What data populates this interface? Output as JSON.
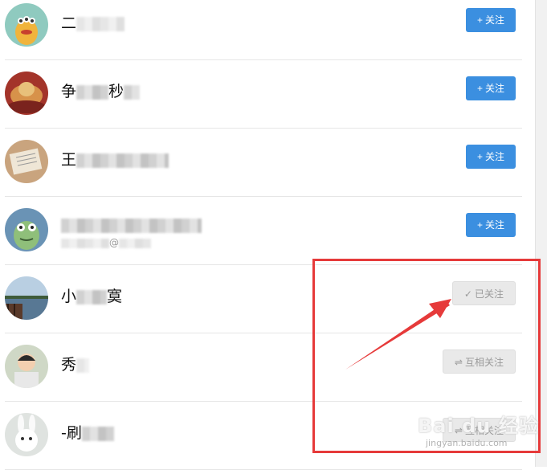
{
  "users": [
    {
      "name_visible": "二",
      "avatar_icon": "monster-avatar",
      "button": {
        "glyph": "+",
        "label": "关注",
        "state": "follow"
      }
    },
    {
      "name_visible": "争",
      "name_tail": "秒",
      "avatar_icon": "food-avatar",
      "button": {
        "glyph": "+",
        "label": "关注",
        "state": "follow"
      }
    },
    {
      "name_visible": "王",
      "avatar_icon": "book-avatar",
      "button": {
        "glyph": "+",
        "label": "关注",
        "state": "follow"
      }
    },
    {
      "name_visible": "",
      "sub_tail": "@",
      "avatar_icon": "frog-avatar",
      "button": {
        "glyph": "+",
        "label": "关注",
        "state": "follow"
      }
    },
    {
      "name_visible": "小",
      "name_tail": "寞",
      "avatar_icon": "lake-avatar",
      "button": {
        "glyph": "✓",
        "label": "已关注",
        "state": "followed"
      }
    },
    {
      "name_visible": "秀",
      "avatar_icon": "child-avatar",
      "button": {
        "glyph": "⇌",
        "label": "互相关注",
        "state": "mutual"
      }
    },
    {
      "name_visible": "-刷",
      "avatar_icon": "bunny-avatar",
      "button": {
        "glyph": "⇌",
        "label": "互相关注",
        "state": "mutual"
      }
    }
  ],
  "annotation": {
    "box_color": "#e63a3a",
    "arrow_color": "#e63a3a"
  },
  "watermark": {
    "text": "Bai du 经验",
    "sub": "jingyan.baidu.com"
  },
  "colors": {
    "follow_button": "#3b8fe0",
    "followed_button": "#e9e9e9"
  }
}
